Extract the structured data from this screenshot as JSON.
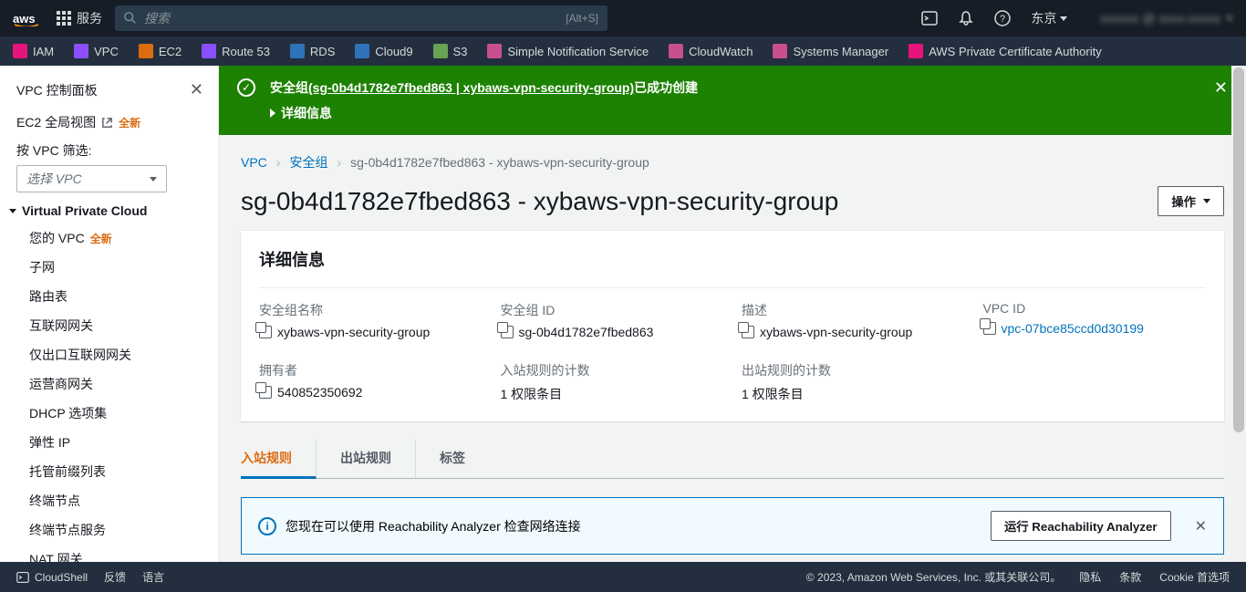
{
  "topnav": {
    "services": "服务",
    "search_placeholder": "搜索",
    "search_hint": "[Alt+S]",
    "region": "东京",
    "user": "xxxxxx @ xxxx-xxxxx"
  },
  "svcbar": [
    {
      "label": "IAM",
      "color": "bg-red"
    },
    {
      "label": "VPC",
      "color": "bg-purple"
    },
    {
      "label": "EC2",
      "color": "bg-orange"
    },
    {
      "label": "Route 53",
      "color": "bg-purple"
    },
    {
      "label": "RDS",
      "color": "bg-blue"
    },
    {
      "label": "Cloud9",
      "color": "bg-blue"
    },
    {
      "label": "S3",
      "color": "bg-green"
    },
    {
      "label": "Simple Notification Service",
      "color": "bg-dpink"
    },
    {
      "label": "CloudWatch",
      "color": "bg-dpink"
    },
    {
      "label": "Systems Manager",
      "color": "bg-dpink"
    },
    {
      "label": "AWS Private Certificate Authority",
      "color": "bg-red"
    }
  ],
  "sidebar": {
    "title": "VPC 控制面板",
    "global_view": "EC2 全局视图",
    "new_badge": "全新",
    "filter_label": "按 VPC 筛选:",
    "filter_placeholder": "选择 VPC",
    "section": "Virtual Private Cloud",
    "items": [
      "您的 VPC",
      "子网",
      "路由表",
      "互联网网关",
      "仅出口互联网网关",
      "运营商网关",
      "DHCP 选项集",
      "弹性 IP",
      "托管前缀列表",
      "终端节点",
      "终端节点服务",
      "NAT 网关"
    ]
  },
  "banner": {
    "prefix": "安全组",
    "link": "(sg-0b4d1782e7fbed863 | xybaws-vpn-security-group)",
    "suffix": "已成功创建",
    "details": "详细信息"
  },
  "breadcrumb": {
    "vpc": "VPC",
    "sg": "安全组",
    "current": "sg-0b4d1782e7fbed863 - xybaws-vpn-security-group"
  },
  "page": {
    "title": "sg-0b4d1782e7fbed863 - xybaws-vpn-security-group",
    "actions": "操作"
  },
  "details": {
    "heading": "详细信息",
    "name_label": "安全组名称",
    "name_value": "xybaws-vpn-security-group",
    "id_label": "安全组 ID",
    "id_value": "sg-0b4d1782e7fbed863",
    "desc_label": "描述",
    "desc_value": "xybaws-vpn-security-group",
    "vpc_label": "VPC ID",
    "vpc_value": "vpc-07bce85ccd0d30199",
    "owner_label": "拥有者",
    "owner_value": "540852350692",
    "inbound_label": "入站规则的计数",
    "inbound_value": "1 权限条目",
    "outbound_label": "出站规则的计数",
    "outbound_value": "1 权限条目"
  },
  "tabs": {
    "inbound": "入站规则",
    "outbound": "出站规则",
    "tags": "标签"
  },
  "reach": {
    "msg": "您现在可以使用 Reachability Analyzer 检查网络连接",
    "btn": "运行 Reachability Analyzer"
  },
  "footer": {
    "cloudshell": "CloudShell",
    "feedback": "反馈",
    "lang": "语言",
    "copyright": "© 2023, Amazon Web Services, Inc. 或其关联公司。",
    "privacy": "隐私",
    "terms": "条款",
    "cookie": "Cookie 首选项"
  }
}
